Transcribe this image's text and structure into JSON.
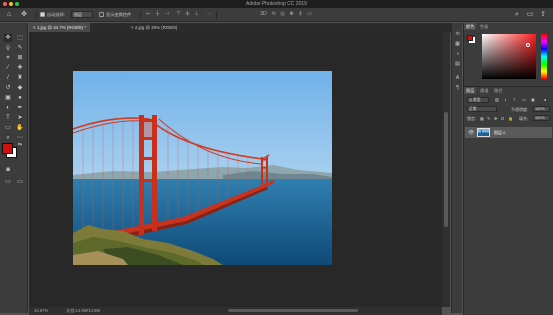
{
  "window": {
    "title": "Adobe Photoshop CC 2019",
    "traffic_lights": [
      "#fc5f57",
      "#fdbc2e",
      "#28c840"
    ]
  },
  "options_bar": {
    "auto_select_label": "自动选择:",
    "auto_select_target": "图层",
    "show_transform_label": "显示变换控件",
    "icons": [
      "home-icon",
      "move-icon",
      "align-left-icon",
      "align-center-icon",
      "align-right-icon",
      "align-top-icon",
      "align-middle-icon",
      "align-bottom-icon",
      "distribute-icon",
      "3d-mode-icon",
      "search-icon",
      "workspace-icon",
      "share-icon"
    ]
  },
  "tabs": [
    {
      "label": "1.jpg @ 34.7% (RGB/8) *",
      "close": "×"
    },
    {
      "label": "2.jpg @ 25% (RGB/8)",
      "close": "×"
    }
  ],
  "status": {
    "zoom": "34.67%",
    "doc_size": "文档:14.9M/14.9M"
  },
  "color_swatch": {
    "foreground": "#d20f0f",
    "background": "#ffffff"
  },
  "color_panel": {
    "tabs": [
      "颜色",
      "色板"
    ],
    "hue_base": "#ff2020"
  },
  "layers_panel": {
    "tabs": [
      "图层",
      "通道",
      "路径"
    ],
    "kind_label": "Q 类型",
    "blend_mode": "正常",
    "opacity_label": "不透明度:",
    "opacity_value": "100%",
    "lock_label": "锁定:",
    "fill_label": "填充:",
    "fill_value": "100%",
    "layer_name": "图层 0"
  }
}
